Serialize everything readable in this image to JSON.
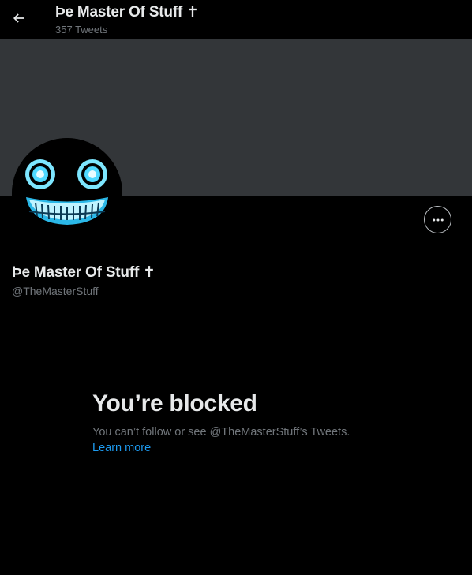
{
  "header": {
    "title": "Þe Master Of Stuff ✝",
    "tweet_count": "357 Tweets"
  },
  "profile": {
    "display_name": "Þe Master Of Stuff ✝",
    "handle": "@TheMasterStuff"
  },
  "blocked": {
    "title": "You’re blocked",
    "message": "You can’t follow or see @TheMasterStuff’s Tweets.",
    "learn_more": "Learn more"
  },
  "icons": {
    "back": "arrow-left-icon",
    "more": "more-horizontal-icon"
  },
  "colors": {
    "background": "#000000",
    "banner": "#333639",
    "primary_text": "#e7e9ea",
    "secondary_text": "#71767b",
    "link": "#1d9bf0",
    "avatar_glow": "#4fd8ff"
  }
}
